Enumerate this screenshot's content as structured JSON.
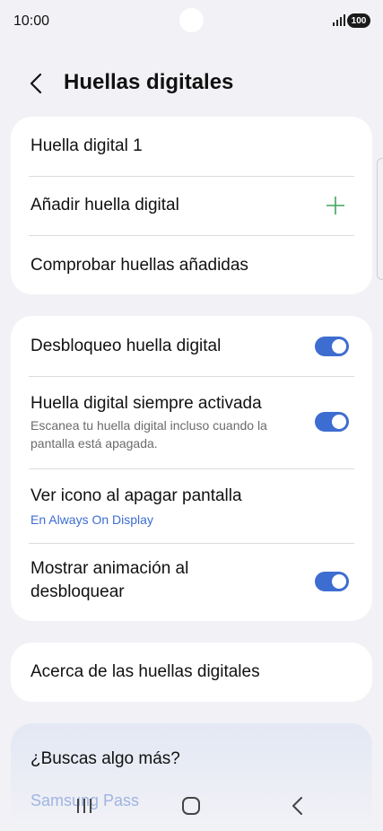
{
  "status": {
    "time": "10:00",
    "battery": "100"
  },
  "header": {
    "title": "Huellas digitales"
  },
  "card1": {
    "items": [
      {
        "label": "Huella digital 1"
      },
      {
        "label": "Añadir huella digital"
      },
      {
        "label": "Comprobar huellas añadidas"
      }
    ]
  },
  "card2": {
    "items": [
      {
        "label": "Desbloqueo huella digital",
        "on": true
      },
      {
        "label": "Huella digital siempre activada",
        "desc": "Escanea tu huella digital incluso cuando la pantalla está apagada.",
        "on": true
      },
      {
        "label": "Ver icono al apagar pantalla",
        "sub": "En Always On Display"
      },
      {
        "label": "Mostrar animación al desbloquear",
        "on": true
      }
    ]
  },
  "card3": {
    "label": "Acerca de las huellas digitales"
  },
  "suggest": {
    "title": "¿Buscas algo más?",
    "item": "Samsung Pass"
  },
  "colors": {
    "accent": "#3e6dd1",
    "plus": "#3fa55a",
    "background": "#f2f2f6"
  }
}
